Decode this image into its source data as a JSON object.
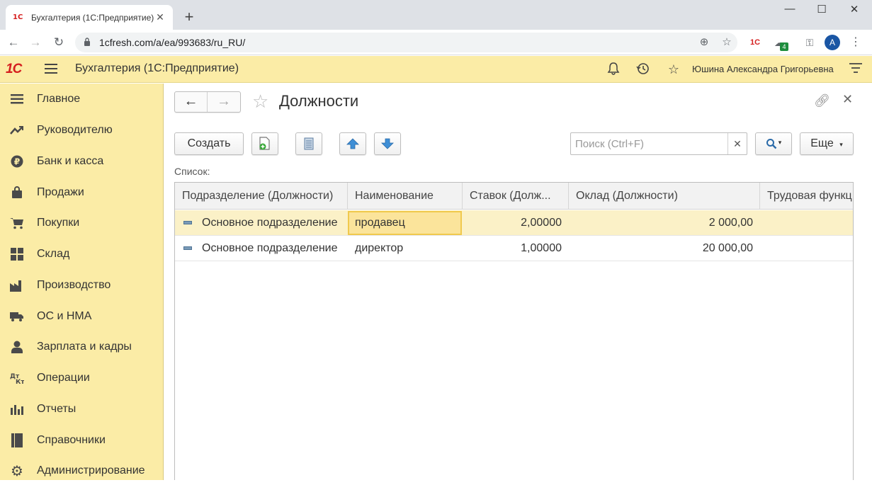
{
  "browser": {
    "tab_title": "Бухгалтерия (1С:Предприятие)",
    "tab_favicon": "1С",
    "url": "1cfresh.com/a/ea/993683/ru_RU/",
    "extension_badge": "4",
    "avatar_letter": "A"
  },
  "header": {
    "logo": "1С",
    "app_title": "Бухгалтерия  (1С:Предприятие)",
    "user_name": "Юшина Александра Григорьевна"
  },
  "sidebar": {
    "items": [
      {
        "label": "Главное",
        "icon": "menu-lines-icon"
      },
      {
        "label": "Руководителю",
        "icon": "trend-chart-icon"
      },
      {
        "label": "Банк и касса",
        "icon": "ruble-coin-icon"
      },
      {
        "label": "Продажи",
        "icon": "shopping-bag-icon"
      },
      {
        "label": "Покупки",
        "icon": "cart-icon"
      },
      {
        "label": "Склад",
        "icon": "warehouse-grid-icon"
      },
      {
        "label": "Производство",
        "icon": "factory-icon"
      },
      {
        "label": "ОС и НМА",
        "icon": "truck-icon"
      },
      {
        "label": "Зарплата и кадры",
        "icon": "person-icon"
      },
      {
        "label": "Операции",
        "icon": "dt-kt-icon"
      },
      {
        "label": "Отчеты",
        "icon": "bar-chart-icon"
      },
      {
        "label": "Справочники",
        "icon": "book-icon"
      },
      {
        "label": "Администрирование",
        "icon": "gear-icon"
      }
    ]
  },
  "form": {
    "title": "Должности",
    "create_label": "Создать",
    "more_label": "Еще",
    "search_placeholder": "Поиск (Ctrl+F)",
    "list_label": "Список:",
    "columns": [
      "Подразделение (Должности)",
      "Наименование",
      "Ставок (Долж...",
      "Оклад (Должности)",
      "Трудовая функц"
    ],
    "rows": [
      {
        "department": "Основное подразделение",
        "name": "продавец",
        "rate": "2,00000",
        "salary": "2 000,00",
        "function": ""
      },
      {
        "department": "Основное подразделение",
        "name": "директор",
        "rate": "1,00000",
        "salary": "20 000,00",
        "function": ""
      }
    ]
  },
  "colors": {
    "accent_yellow": "#fbeca6",
    "selected_row": "#fbf1c7",
    "focused_cell": "#fbe49b",
    "logo_red": "#d51f1f",
    "arrow_blue": "#3f8fd6"
  }
}
